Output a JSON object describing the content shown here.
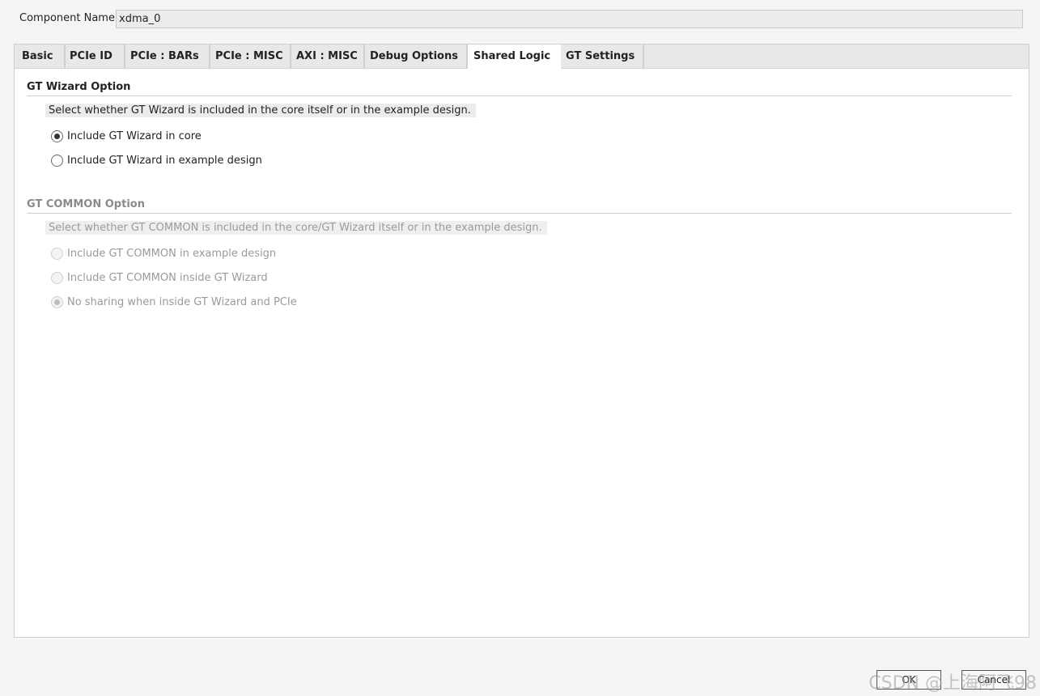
{
  "component": {
    "label": "Component Name",
    "value": "xdma_0"
  },
  "tabs": [
    {
      "label": "Basic"
    },
    {
      "label": "PCIe ID"
    },
    {
      "label": "PCIe : BARs"
    },
    {
      "label": "PCIe : MISC"
    },
    {
      "label": "AXI : MISC"
    },
    {
      "label": "Debug Options"
    },
    {
      "label": "Shared Logic",
      "active": true
    },
    {
      "label": "GT Settings"
    }
  ],
  "gt_wizard": {
    "title": "GT Wizard Option",
    "description": "Select whether GT Wizard is included in the core itself or in the example design.",
    "options": [
      {
        "label": "Include GT Wizard in core",
        "checked": true,
        "enabled": true
      },
      {
        "label": "Include GT Wizard in example design",
        "checked": false,
        "enabled": true
      }
    ]
  },
  "gt_common": {
    "title": "GT COMMON Option",
    "description": "Select whether GT COMMON is included in the core/GT Wizard itself or in the example design.",
    "options": [
      {
        "label": "Include GT COMMON in example design",
        "checked": false,
        "enabled": false
      },
      {
        "label": "Include GT COMMON inside GT Wizard",
        "checked": false,
        "enabled": false
      },
      {
        "label": "No sharing when inside GT Wizard and PCIe",
        "checked": true,
        "enabled": false
      }
    ]
  },
  "buttons": {
    "ok": "OK",
    "cancel": "Cancel"
  },
  "watermark": "CSDN @上海阿飞98"
}
